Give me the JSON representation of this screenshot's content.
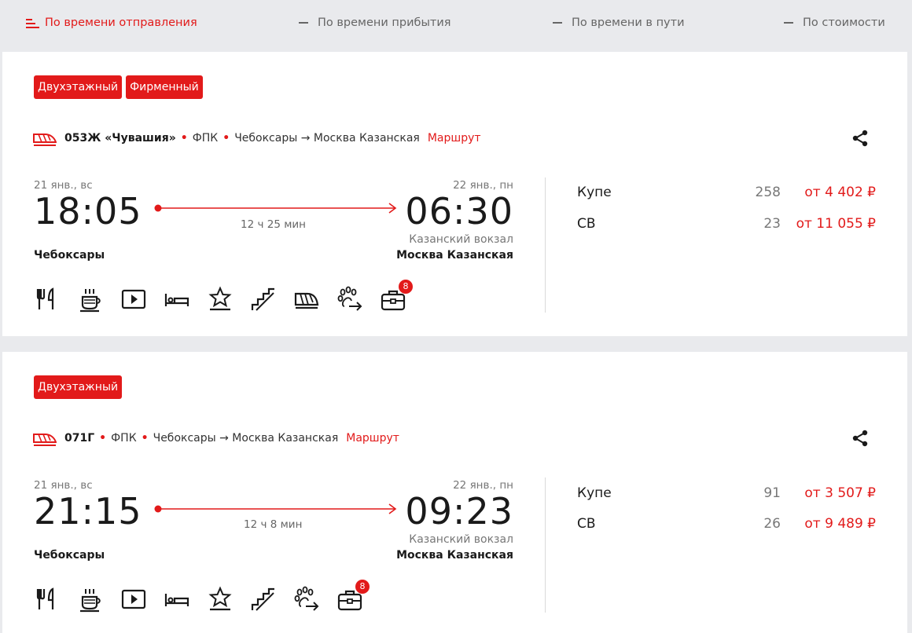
{
  "sort": {
    "items": [
      {
        "label": "По времени отправления",
        "active": true
      },
      {
        "label": "По времени прибытия",
        "active": false
      },
      {
        "label": "По времени в пути",
        "active": false
      },
      {
        "label": "По стоимости",
        "active": false
      }
    ]
  },
  "trains": [
    {
      "badges": [
        "Двухэтажный",
        "Фирменный"
      ],
      "number": "053Ж «Чувашия»",
      "carrier": "ФПК",
      "route": "Чебоксары → Москва Казанская",
      "route_link": "Маршрут",
      "dep_date": "21 янв., вс",
      "dep_time": "18:05",
      "dep_city": "Чебоксары",
      "arr_date": "22 янв., пн",
      "arr_time": "06:30",
      "arr_station": "Казанский вокзал",
      "arr_city": "Москва Казанская",
      "duration": "12 ч 25 мин",
      "amenities": [
        "restaurant-icon",
        "hot-drinks-icon",
        "video-icon",
        "bed-linen-icon",
        "premium-icon",
        "stairs-icon",
        "express-train-icon",
        "pets-icon",
        "luggage-icon"
      ],
      "luggage_count": "8",
      "prices": [
        {
          "class": "Купе",
          "seats": "258",
          "price": "от 4 402 ₽"
        },
        {
          "class": "СВ",
          "seats": "23",
          "price": "от 11 055 ₽"
        }
      ]
    },
    {
      "badges": [
        "Двухэтажный"
      ],
      "number": "071Г",
      "carrier": "ФПК",
      "route": "Чебоксары → Москва Казанская",
      "route_link": "Маршрут",
      "dep_date": "21 янв., вс",
      "dep_time": "21:15",
      "dep_city": "Чебоксары",
      "arr_date": "22 янв., пн",
      "arr_time": "09:23",
      "arr_station": "Казанский вокзал",
      "arr_city": "Москва Казанская",
      "duration": "12 ч 8 мин",
      "amenities": [
        "restaurant-icon",
        "hot-drinks-icon",
        "video-icon",
        "bed-linen-icon",
        "premium-icon",
        "stairs-icon",
        "pets-icon",
        "luggage-icon"
      ],
      "luggage_count": "8",
      "prices": [
        {
          "class": "Купе",
          "seats": "91",
          "price": "от 3 507 ₽"
        },
        {
          "class": "СВ",
          "seats": "26",
          "price": "от 9 489 ₽"
        }
      ]
    }
  ],
  "colors": {
    "accent": "#e21a1a",
    "background": "#e9eaed",
    "card": "#ffffff"
  }
}
